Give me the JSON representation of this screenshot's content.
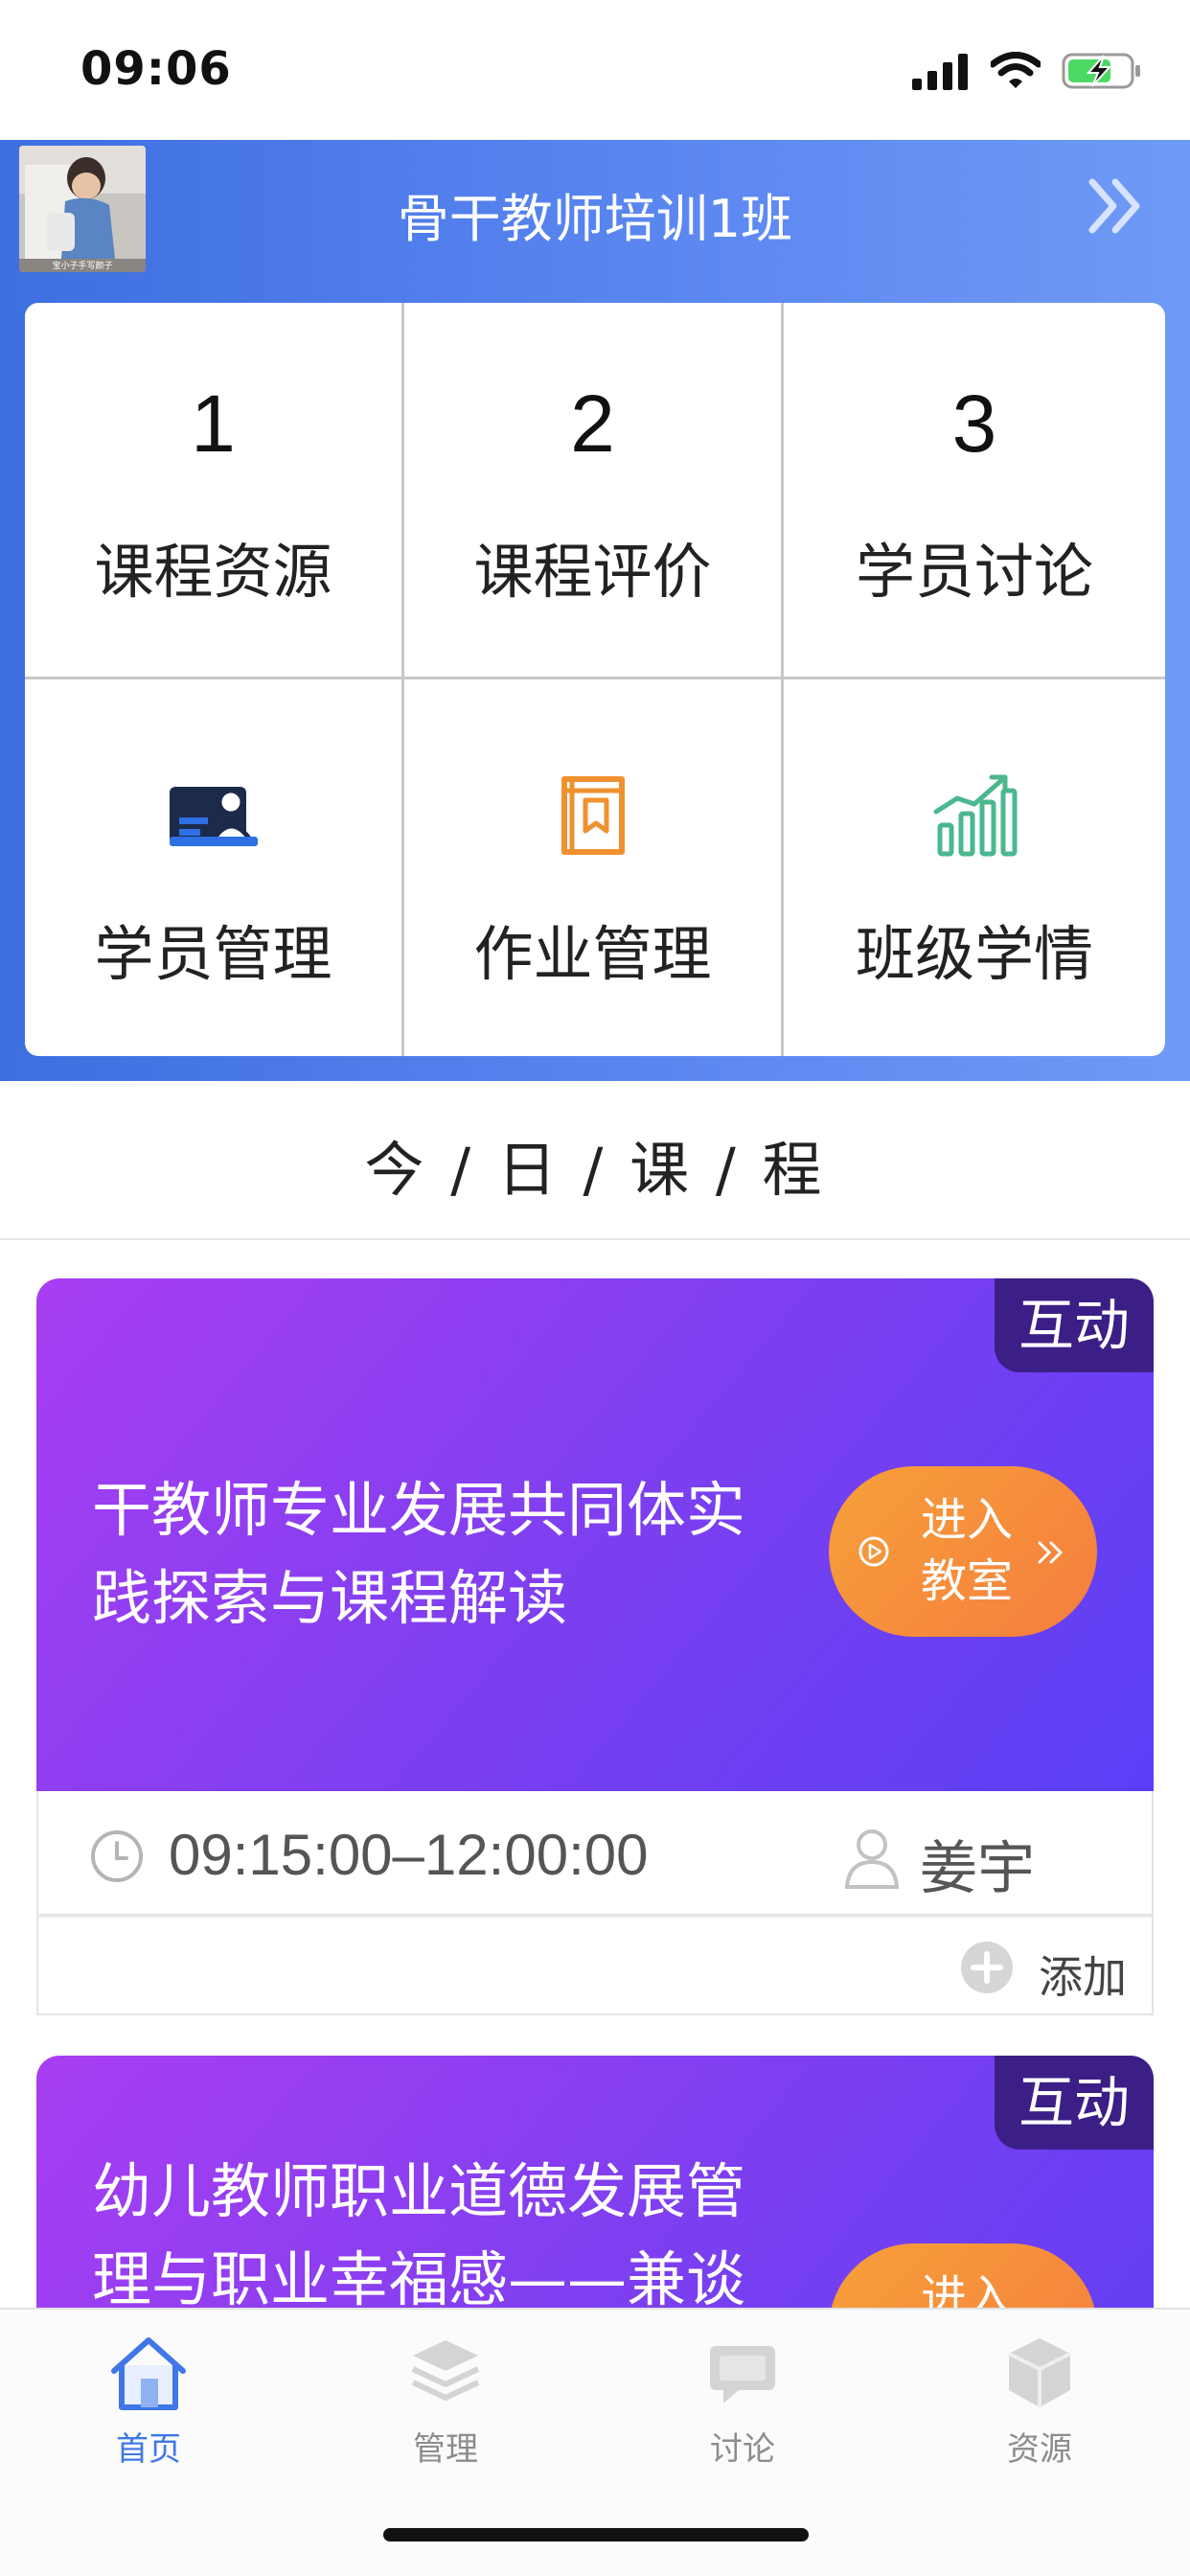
{
  "status_bar": {
    "time": "09:06"
  },
  "header": {
    "class_title": "骨干教师培训1班",
    "avatar_caption": "宝小子手写颜子"
  },
  "stats": [
    {
      "value": "1",
      "label": "课程资源"
    },
    {
      "value": "2",
      "label": "课程评价"
    },
    {
      "value": "3",
      "label": "学员讨论"
    }
  ],
  "tools": [
    {
      "icon": "student-card-icon",
      "label": "学员管理",
      "color": "#2f6fe4"
    },
    {
      "icon": "book-bookmark-icon",
      "label": "作业管理",
      "color": "#f0912f"
    },
    {
      "icon": "growth-chart-icon",
      "label": "班级学情",
      "color": "#4bb78f"
    }
  ],
  "today": {
    "title": "今 / 日 / 课 / 程"
  },
  "courses": [
    {
      "tag": "互动",
      "name_line1": "干教师专业发展共同体实",
      "name_line2": "践探索与课程解读",
      "enter_line1": "进入",
      "enter_line2": "教室",
      "time": "09:15:00–12:00:00",
      "teacher": "姜宇",
      "add_label": "添加"
    },
    {
      "tag": "互动",
      "name_line1": "幼儿教师职业道德发展管",
      "name_line2": "理与职业幸福感——兼谈",
      "enter_line1": "进入"
    }
  ],
  "tabbar": [
    {
      "label": "首页",
      "icon": "home-icon"
    },
    {
      "label": "管理",
      "icon": "layers-icon"
    },
    {
      "label": "讨论",
      "icon": "chat-icon"
    },
    {
      "label": "资源",
      "icon": "cube-icon"
    }
  ],
  "colors": {
    "header_gradient_start": "#3e6fe0",
    "header_gradient_end": "#6f9af6",
    "course_gradient_start": "#a93ef2",
    "course_gradient_end": "#5a3ff6",
    "tag_bg": "#3b1f86",
    "enter_btn": "#f57d3e",
    "active_tab": "#3f77e6"
  }
}
